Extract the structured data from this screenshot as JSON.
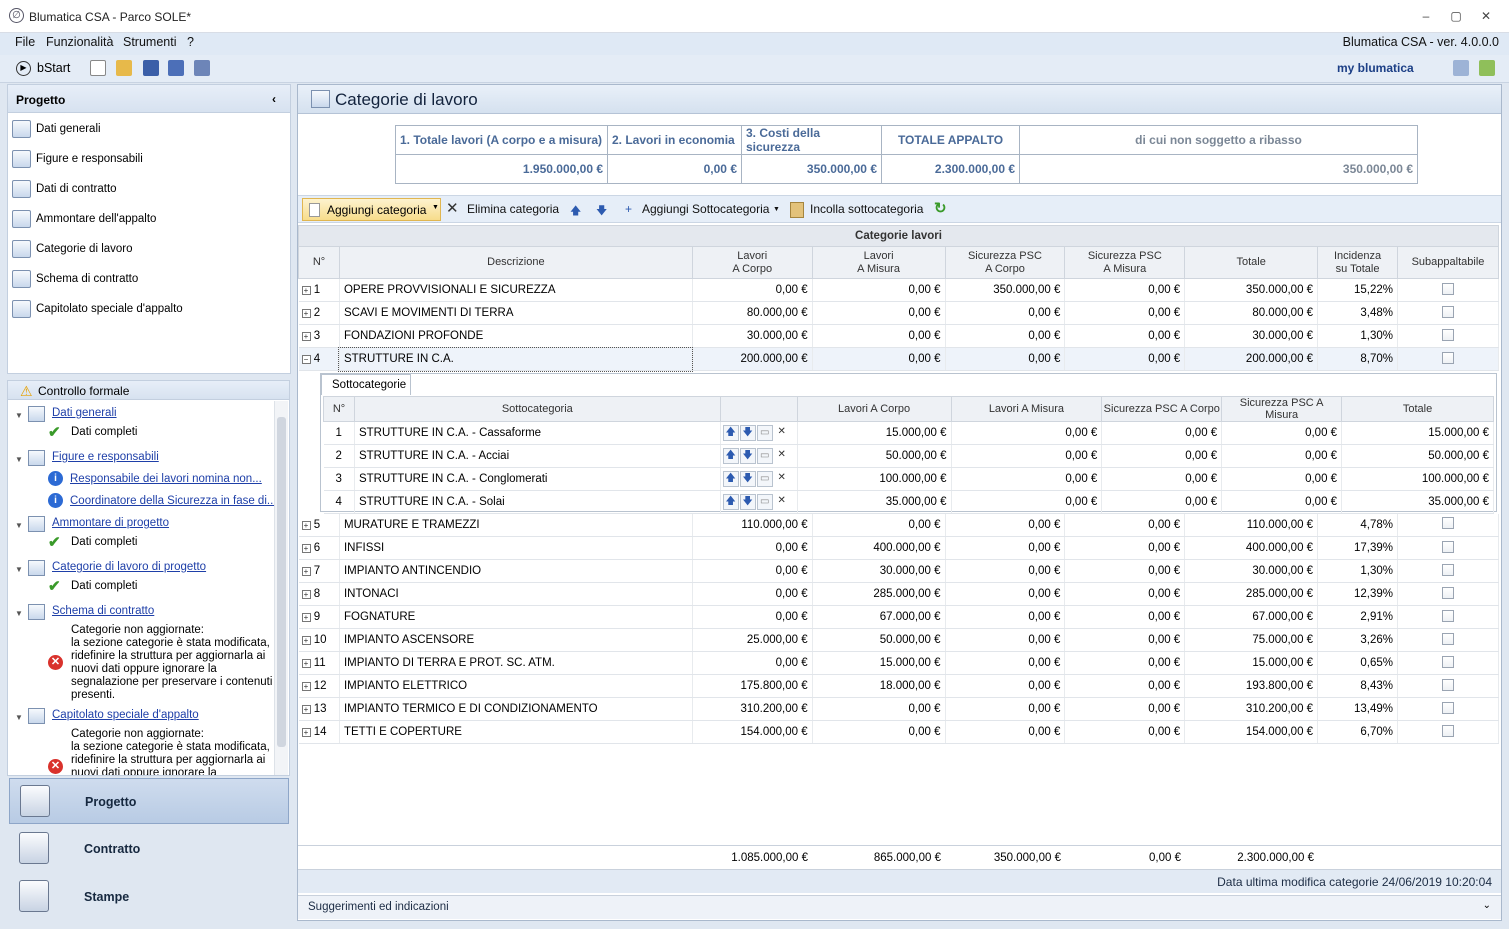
{
  "window": {
    "title": "Blumatica CSA - Parco SOLE*"
  },
  "menu": {
    "items": [
      "File",
      "Funzionalità",
      "Strumenti",
      "?"
    ],
    "version": "Blumatica CSA - ver. 4.0.0.0"
  },
  "toolbar": {
    "bstart": "bStart",
    "brand": "my blumatica"
  },
  "project_panel": {
    "title": "Progetto",
    "items": [
      "Dati generali",
      "Figure e responsabili",
      "Dati di contratto",
      "Ammontare dell'appalto",
      "Categorie di lavoro",
      "Schema di contratto",
      "Capitolato speciale d'appalto"
    ]
  },
  "controllo": {
    "title": "Controllo formale",
    "nodes": {
      "dati_generali": "Dati generali",
      "dati_completi": "Dati completi",
      "figure": "Figure e responsabili",
      "resp": "Responsabile dei lavori nomina non...",
      "coord": "Coordinatore della Sicurezza in fase di...",
      "ammontare": "Ammontare di progetto",
      "categorie": "Categorie di lavoro di progetto",
      "schema": "Schema di contratto",
      "capitolato": "Capitolato speciale d'appalto",
      "err_msg": [
        "Categorie non aggiornate:",
        "la sezione categorie è stata modificata,",
        "ridefinire la struttura per aggiornarla ai",
        "nuovi dati oppure ignorare la",
        "segnalazione per preservare i contenuti",
        "presenti."
      ]
    }
  },
  "nav_buttons": [
    "Progetto",
    "Contratto",
    "Stampe"
  ],
  "main": {
    "title": "Categorie di lavoro",
    "summary": {
      "headers": [
        "1. Totale lavori (A corpo e a misura)",
        "2. Lavori in economia",
        "3. Costi della sicurezza",
        "TOTALE APPALTO",
        "di cui non soggetto a ribasso"
      ],
      "values": [
        "1.950.000,00 €",
        "0,00 €",
        "350.000,00 €",
        "2.300.000,00 €",
        "350.000,00 €"
      ]
    },
    "actions": {
      "add": "Aggiungi categoria",
      "delete": "Elimina categoria",
      "add_sub": "Aggiungi Sottocategoria",
      "paste_sub": "Incolla sottocategoria"
    },
    "grid_title": "Categorie lavori",
    "columns": [
      "N°",
      "Descrizione",
      "Lavori\nA Corpo",
      "Lavori\nA Misura",
      "Sicurezza PSC\nA Corpo",
      "Sicurezza PSC\nA Misura",
      "Totale",
      "Incidenza\nsu Totale",
      "Subappaltabile"
    ],
    "rows_top": [
      [
        "1",
        "OPERE PROVVISIONALI E SICUREZZA",
        "0,00 €",
        "0,00 €",
        "350.000,00 €",
        "0,00 €",
        "350.000,00 €",
        "15,22%"
      ],
      [
        "2",
        "SCAVI E MOVIMENTI DI TERRA",
        "80.000,00 €",
        "0,00 €",
        "0,00 €",
        "0,00 €",
        "80.000,00 €",
        "3,48%"
      ],
      [
        "3",
        "FONDAZIONI PROFONDE",
        "30.000,00 €",
        "0,00 €",
        "0,00 €",
        "0,00 €",
        "30.000,00 €",
        "1,30%"
      ],
      [
        "4",
        "STRUTTURE IN C.A.",
        "200.000,00 €",
        "0,00 €",
        "0,00 €",
        "0,00 €",
        "200.000,00 €",
        "8,70%"
      ]
    ],
    "sub_tab": "Sottocategorie",
    "sub_columns": [
      "N°",
      "Sottocategoria",
      "Lavori A Corpo",
      "Lavori A Misura",
      "Sicurezza PSC A Corpo",
      "Sicurezza PSC A Misura",
      "Totale"
    ],
    "sub_rows": [
      [
        "1",
        "STRUTTURE IN C.A. - Cassaforme",
        "15.000,00 €",
        "0,00 €",
        "0,00 €",
        "0,00 €",
        "15.000,00 €"
      ],
      [
        "2",
        "STRUTTURE IN C.A. - Acciai",
        "50.000,00 €",
        "0,00 €",
        "0,00 €",
        "0,00 €",
        "50.000,00 €"
      ],
      [
        "3",
        "STRUTTURE IN C.A. - Conglomerati",
        "100.000,00 €",
        "0,00 €",
        "0,00 €",
        "0,00 €",
        "100.000,00 €"
      ],
      [
        "4",
        "STRUTTURE IN C.A. - Solai",
        "35.000,00 €",
        "0,00 €",
        "0,00 €",
        "0,00 €",
        "35.000,00 €"
      ]
    ],
    "rows_bottom": [
      [
        "5",
        "MURATURE E TRAMEZZI",
        "110.000,00 €",
        "0,00 €",
        "0,00 €",
        "0,00 €",
        "110.000,00 €",
        "4,78%"
      ],
      [
        "6",
        "INFISSI",
        "0,00 €",
        "400.000,00 €",
        "0,00 €",
        "0,00 €",
        "400.000,00 €",
        "17,39%"
      ],
      [
        "7",
        "IMPIANTO ANTINCENDIO",
        "0,00 €",
        "30.000,00 €",
        "0,00 €",
        "0,00 €",
        "30.000,00 €",
        "1,30%"
      ],
      [
        "8",
        "INTONACI",
        "0,00 €",
        "285.000,00 €",
        "0,00 €",
        "0,00 €",
        "285.000,00 €",
        "12,39%"
      ],
      [
        "9",
        "FOGNATURE",
        "0,00 €",
        "67.000,00 €",
        "0,00 €",
        "0,00 €",
        "67.000,00 €",
        "2,91%"
      ],
      [
        "10",
        "IMPIANTO ASCENSORE",
        "25.000,00 €",
        "50.000,00 €",
        "0,00 €",
        "0,00 €",
        "75.000,00 €",
        "3,26%"
      ],
      [
        "11",
        "IMPIANTO DI TERRA E PROT. SC. ATM.",
        "0,00 €",
        "15.000,00 €",
        "0,00 €",
        "0,00 €",
        "15.000,00 €",
        "0,65%"
      ],
      [
        "12",
        "IMPIANTO ELETTRICO",
        "175.800,00 €",
        "18.000,00 €",
        "0,00 €",
        "0,00 €",
        "193.800,00 €",
        "8,43%"
      ],
      [
        "13",
        "IMPIANTO TERMICO E DI CONDIZIONAMENTO",
        "310.200,00 €",
        "0,00 €",
        "0,00 €",
        "0,00 €",
        "310.200,00 €",
        "13,49%"
      ],
      [
        "14",
        "TETTI E COPERTURE",
        "154.000,00 €",
        "0,00 €",
        "0,00 €",
        "0,00 €",
        "154.000,00 €",
        "6,70%"
      ]
    ],
    "totals": [
      "1.085.000,00 €",
      "865.000,00 €",
      "350.000,00 €",
      "0,00 €",
      "2.300.000,00 €"
    ],
    "status": "Data ultima modifica categorie 24/06/2019 10:20:04",
    "hints": "Suggerimenti ed indicazioni"
  },
  "colors": {
    "accent": "#4a6a98",
    "header_bg": "#dfe9f5",
    "error": "#d9322c",
    "ok": "#3a9a2a"
  }
}
